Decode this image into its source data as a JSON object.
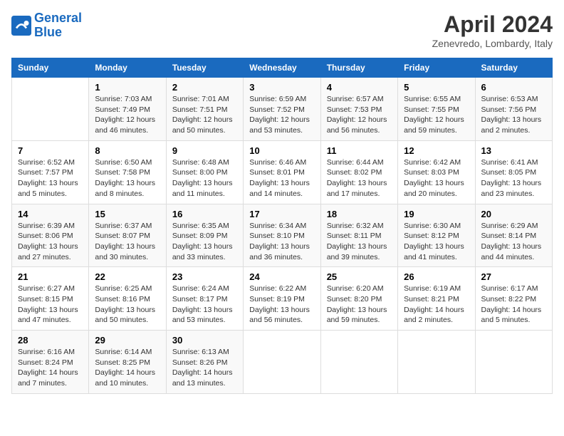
{
  "header": {
    "logo_line1": "General",
    "logo_line2": "Blue",
    "month_title": "April 2024",
    "subtitle": "Zenevredo, Lombardy, Italy"
  },
  "weekdays": [
    "Sunday",
    "Monday",
    "Tuesday",
    "Wednesday",
    "Thursday",
    "Friday",
    "Saturday"
  ],
  "weeks": [
    [
      {
        "day": "",
        "info": ""
      },
      {
        "day": "1",
        "info": "Sunrise: 7:03 AM\nSunset: 7:49 PM\nDaylight: 12 hours\nand 46 minutes."
      },
      {
        "day": "2",
        "info": "Sunrise: 7:01 AM\nSunset: 7:51 PM\nDaylight: 12 hours\nand 50 minutes."
      },
      {
        "day": "3",
        "info": "Sunrise: 6:59 AM\nSunset: 7:52 PM\nDaylight: 12 hours\nand 53 minutes."
      },
      {
        "day": "4",
        "info": "Sunrise: 6:57 AM\nSunset: 7:53 PM\nDaylight: 12 hours\nand 56 minutes."
      },
      {
        "day": "5",
        "info": "Sunrise: 6:55 AM\nSunset: 7:55 PM\nDaylight: 12 hours\nand 59 minutes."
      },
      {
        "day": "6",
        "info": "Sunrise: 6:53 AM\nSunset: 7:56 PM\nDaylight: 13 hours\nand 2 minutes."
      }
    ],
    [
      {
        "day": "7",
        "info": "Sunrise: 6:52 AM\nSunset: 7:57 PM\nDaylight: 13 hours\nand 5 minutes."
      },
      {
        "day": "8",
        "info": "Sunrise: 6:50 AM\nSunset: 7:58 PM\nDaylight: 13 hours\nand 8 minutes."
      },
      {
        "day": "9",
        "info": "Sunrise: 6:48 AM\nSunset: 8:00 PM\nDaylight: 13 hours\nand 11 minutes."
      },
      {
        "day": "10",
        "info": "Sunrise: 6:46 AM\nSunset: 8:01 PM\nDaylight: 13 hours\nand 14 minutes."
      },
      {
        "day": "11",
        "info": "Sunrise: 6:44 AM\nSunset: 8:02 PM\nDaylight: 13 hours\nand 17 minutes."
      },
      {
        "day": "12",
        "info": "Sunrise: 6:42 AM\nSunset: 8:03 PM\nDaylight: 13 hours\nand 20 minutes."
      },
      {
        "day": "13",
        "info": "Sunrise: 6:41 AM\nSunset: 8:05 PM\nDaylight: 13 hours\nand 23 minutes."
      }
    ],
    [
      {
        "day": "14",
        "info": "Sunrise: 6:39 AM\nSunset: 8:06 PM\nDaylight: 13 hours\nand 27 minutes."
      },
      {
        "day": "15",
        "info": "Sunrise: 6:37 AM\nSunset: 8:07 PM\nDaylight: 13 hours\nand 30 minutes."
      },
      {
        "day": "16",
        "info": "Sunrise: 6:35 AM\nSunset: 8:09 PM\nDaylight: 13 hours\nand 33 minutes."
      },
      {
        "day": "17",
        "info": "Sunrise: 6:34 AM\nSunset: 8:10 PM\nDaylight: 13 hours\nand 36 minutes."
      },
      {
        "day": "18",
        "info": "Sunrise: 6:32 AM\nSunset: 8:11 PM\nDaylight: 13 hours\nand 39 minutes."
      },
      {
        "day": "19",
        "info": "Sunrise: 6:30 AM\nSunset: 8:12 PM\nDaylight: 13 hours\nand 41 minutes."
      },
      {
        "day": "20",
        "info": "Sunrise: 6:29 AM\nSunset: 8:14 PM\nDaylight: 13 hours\nand 44 minutes."
      }
    ],
    [
      {
        "day": "21",
        "info": "Sunrise: 6:27 AM\nSunset: 8:15 PM\nDaylight: 13 hours\nand 47 minutes."
      },
      {
        "day": "22",
        "info": "Sunrise: 6:25 AM\nSunset: 8:16 PM\nDaylight: 13 hours\nand 50 minutes."
      },
      {
        "day": "23",
        "info": "Sunrise: 6:24 AM\nSunset: 8:17 PM\nDaylight: 13 hours\nand 53 minutes."
      },
      {
        "day": "24",
        "info": "Sunrise: 6:22 AM\nSunset: 8:19 PM\nDaylight: 13 hours\nand 56 minutes."
      },
      {
        "day": "25",
        "info": "Sunrise: 6:20 AM\nSunset: 8:20 PM\nDaylight: 13 hours\nand 59 minutes."
      },
      {
        "day": "26",
        "info": "Sunrise: 6:19 AM\nSunset: 8:21 PM\nDaylight: 14 hours\nand 2 minutes."
      },
      {
        "day": "27",
        "info": "Sunrise: 6:17 AM\nSunset: 8:22 PM\nDaylight: 14 hours\nand 5 minutes."
      }
    ],
    [
      {
        "day": "28",
        "info": "Sunrise: 6:16 AM\nSunset: 8:24 PM\nDaylight: 14 hours\nand 7 minutes."
      },
      {
        "day": "29",
        "info": "Sunrise: 6:14 AM\nSunset: 8:25 PM\nDaylight: 14 hours\nand 10 minutes."
      },
      {
        "day": "30",
        "info": "Sunrise: 6:13 AM\nSunset: 8:26 PM\nDaylight: 14 hours\nand 13 minutes."
      },
      {
        "day": "",
        "info": ""
      },
      {
        "day": "",
        "info": ""
      },
      {
        "day": "",
        "info": ""
      },
      {
        "day": "",
        "info": ""
      }
    ]
  ]
}
